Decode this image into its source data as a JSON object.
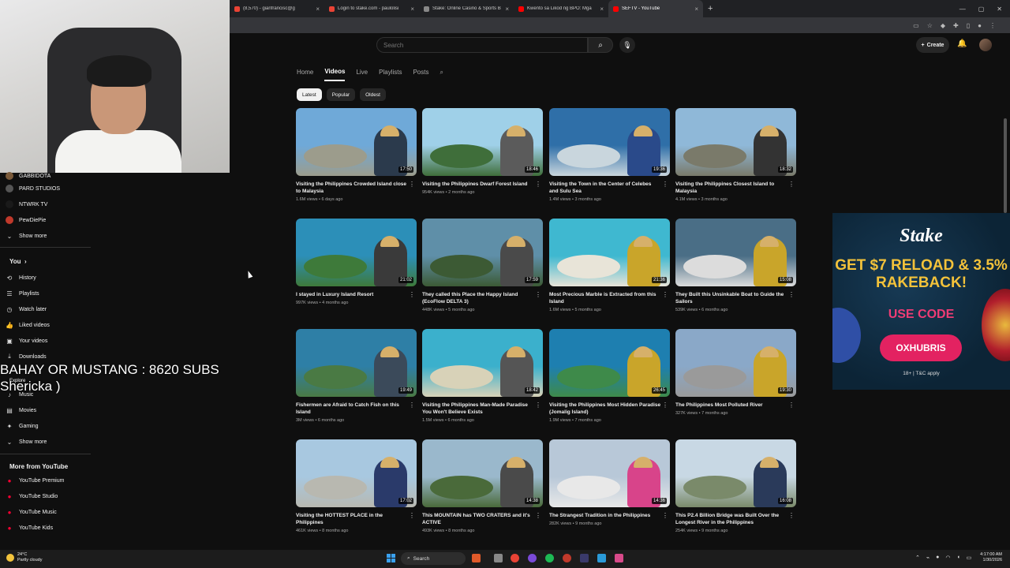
{
  "browser": {
    "tabs": [
      {
        "label": "(8,570) - gianfrancisc@g",
        "color": "#ea4335",
        "active": false
      },
      {
        "label": "Login to stake.com - paulolisi",
        "color": "#ea4335",
        "active": false
      },
      {
        "label": "Stake: Online Casino & Sports B",
        "color": "#888888",
        "active": false
      },
      {
        "label": "Kwento sa Likod ng BPO: Mga",
        "color": "#ff0000",
        "active": false
      },
      {
        "label": "SEFTV - YouTube",
        "color": "#ff0000",
        "active": true
      }
    ],
    "new_tab": "+",
    "close_glyph": "×"
  },
  "sidebar": {
    "subs": [
      {
        "label": "GABBIDOTA",
        "color": "#7a5a3a"
      },
      {
        "label": "PARD STUDIOS",
        "color": "#555555"
      },
      {
        "label": "NTWRK TV",
        "color": "#1a1a1a"
      },
      {
        "label": "PewDiePie",
        "color": "#c0392b"
      }
    ],
    "show_more": "Show more",
    "you_header": "You",
    "you_items": [
      {
        "label": "History",
        "icon": "history-icon",
        "glyph": "⟲"
      },
      {
        "label": "Playlists",
        "icon": "playlists-icon",
        "glyph": "☰"
      },
      {
        "label": "Watch later",
        "icon": "clock-icon",
        "glyph": "◷"
      },
      {
        "label": "Liked videos",
        "icon": "thumbs-up-icon",
        "glyph": "👍"
      },
      {
        "label": "Your videos",
        "icon": "video-icon",
        "glyph": "▣"
      },
      {
        "label": "Downloads",
        "icon": "download-icon",
        "glyph": "⤓"
      }
    ],
    "explore_small": "Explore",
    "explore_items": [
      {
        "label": "Music",
        "icon": "music-icon",
        "glyph": "♪"
      },
      {
        "label": "Movies",
        "icon": "movies-icon",
        "glyph": "▤"
      },
      {
        "label": "Gaming",
        "icon": "gaming-icon",
        "glyph": "✦"
      }
    ],
    "show_more_2": "Show more",
    "more_header": "More from YouTube",
    "more_items": [
      {
        "label": "YouTube Premium"
      },
      {
        "label": "YouTube Studio"
      },
      {
        "label": "YouTube Music"
      },
      {
        "label": "YouTube Kids"
      }
    ]
  },
  "overlay": {
    "line1": "BAHAY OR MUSTANG : 8620 SUBS",
    "line2": "Shericka )"
  },
  "header": {
    "search_placeholder": "Search",
    "create_label": "Create"
  },
  "channel_tabs": [
    "Home",
    "Videos",
    "Live",
    "Playlists",
    "Posts"
  ],
  "active_tab": "Videos",
  "chips": [
    "Latest",
    "Popular",
    "Oldest"
  ],
  "videos": [
    {
      "title": "Visiting the Philippines Crowded Island close to Malaysia",
      "meta": "1.6M views • 6 days ago",
      "duration": "17:50",
      "sky": "#6fa9d8",
      "land": "#9c9c8c",
      "shirt": "#2b3a4c"
    },
    {
      "title": "Visiting the Philippines Dwarf Forest Island",
      "meta": "954K views • 2 months ago",
      "duration": "18:46",
      "sky": "#9fd0e8",
      "land": "#3f6e3a",
      "shirt": "#5b5b5b"
    },
    {
      "title": "Visiting the Town in the Center of Celebes and Sulu Sea",
      "meta": "1.4M views • 3 months ago",
      "duration": "19:36",
      "sky": "#2f6fa8",
      "land": "#c9d6dd",
      "shirt": "#2a4a8a"
    },
    {
      "title": "Visiting the Philippines Closest Island to Malaysia",
      "meta": "4.1M views • 3 months ago",
      "duration": "18:32",
      "sky": "#8fb8d8",
      "land": "#7a7a6a",
      "shirt": "#333333"
    },
    {
      "title": "I stayed in Luxury Island Resort",
      "meta": "997K views • 4 months ago",
      "duration": "21:02",
      "sky": "#2c8fb8",
      "land": "#3e7a3a",
      "shirt": "#3a3a3a"
    },
    {
      "title": "They called this Place the Happy Island (EcoFlow DELTA 3)",
      "meta": "448K views • 5 months ago",
      "duration": "17:59",
      "sky": "#5f8fa8",
      "land": "#3c5a34",
      "shirt": "#4a4a4a"
    },
    {
      "title": "Most Precious Marble is Extracted from this Island",
      "meta": "1.6M views • 5 months ago",
      "duration": "21:36",
      "sky": "#3fb8d0",
      "land": "#e8e4d8",
      "shirt": "#c9a52a"
    },
    {
      "title": "They Built this Unsinkable Boat to Guide the Sailors",
      "meta": "539K views • 6 months ago",
      "duration": "15:08",
      "sky": "#4a6e86",
      "land": "#dcdcdc",
      "shirt": "#c9a52a"
    },
    {
      "title": "Fishermen are Afraid to Catch Fish on this Island",
      "meta": "3M views • 6 months ago",
      "duration": "19:49",
      "sky": "#2e7fa6",
      "land": "#4a7a44",
      "shirt": "#3b4a5a"
    },
    {
      "title": "Visiting the Philippines Man-Made Paradise You Won't Believe Exists",
      "meta": "1.5M views • 6 months ago",
      "duration": "18:42",
      "sky": "#3bb0cc",
      "land": "#d8d2b8",
      "shirt": "#555555"
    },
    {
      "title": "Visiting the Philippines Most Hidden Paradise (Jomalig Island)",
      "meta": "1.9M views • 7 months ago",
      "duration": "26:45",
      "sky": "#1e7fb0",
      "land": "#3e8a4a",
      "shirt": "#c9a52a"
    },
    {
      "title": "The Philippines Most Polluted River",
      "meta": "327K views • 7 months ago",
      "duration": "19:30",
      "sky": "#8aa8c8",
      "land": "#9a9a9a",
      "shirt": "#c9a52a"
    },
    {
      "title": "Visiting the HOTTEST PLACE in the Philippines",
      "meta": "461K views • 8 months ago",
      "duration": "17:02",
      "sky": "#a8c8e0",
      "land": "#b8b8b0",
      "shirt": "#2a3a6a"
    },
    {
      "title": "This MOUNTAIN has TWO CRATERS and it's ACTIVE",
      "meta": "493K views • 8 months ago",
      "duration": "14:38",
      "sky": "#9ab8cc",
      "land": "#4a6a3a",
      "shirt": "#4a4a4a"
    },
    {
      "title": "The Strangest Tradition in the Philippines",
      "meta": "282K views • 9 months ago",
      "duration": "14:36",
      "sky": "#b8c8d8",
      "land": "#e8e8e8",
      "shirt": "#d8448a"
    },
    {
      "title": "This P2.4 Billion Bridge was Built Over the Longest River in the Philippines",
      "meta": "254K views • 9 months ago",
      "duration": "16:08",
      "sky": "#c8d8e4",
      "land": "#7a8a6a",
      "shirt": "#2a3a5a"
    }
  ],
  "ad": {
    "logo": "Stake",
    "headline": "GET $7 RELOAD & 3.5% RAKEBACK!",
    "use_code": "USE CODE",
    "code": "OXHUBRIS",
    "fine": "18+ | T&C apply"
  },
  "taskbar": {
    "weather_temp": "24°C",
    "weather_desc": "Partly cloudy",
    "search": "Search",
    "time": "4:17:00 AM",
    "date": "1/30/2026"
  }
}
